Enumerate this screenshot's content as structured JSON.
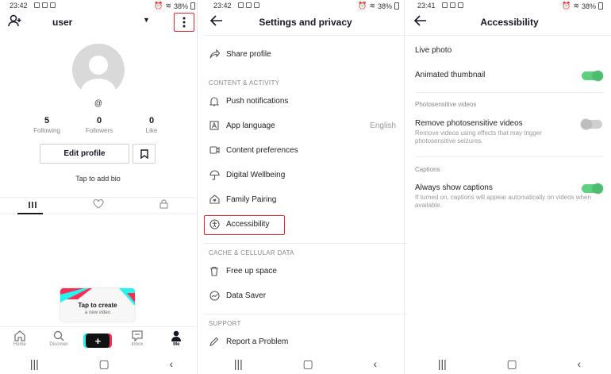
{
  "profile_screen": {
    "status": {
      "time": "23:42",
      "battery": "38%"
    },
    "header": {
      "username": "user"
    },
    "handle": "@",
    "stats": [
      {
        "count": "5",
        "label": "Following"
      },
      {
        "count": "0",
        "label": "Followers"
      },
      {
        "count": "0",
        "label": "Like"
      }
    ],
    "edit_profile_label": "Edit profile",
    "bio_prompt": "Tap to add bio",
    "create_card": {
      "title": "Tap to create",
      "subtitle": "a new video"
    },
    "bottom_nav": [
      {
        "label": "Home",
        "icon": "home-icon"
      },
      {
        "label": "Discover",
        "icon": "search-icon"
      },
      {
        "label": "+",
        "icon": "plus-icon"
      },
      {
        "label": "Inbox",
        "icon": "inbox-icon"
      },
      {
        "label": "Me",
        "icon": "person-icon"
      }
    ],
    "accent_color": "#e0282e"
  },
  "settings_screen": {
    "status": {
      "time": "23:42",
      "battery": "38%"
    },
    "title": "Settings and privacy",
    "share_profile": "Share profile",
    "sections": {
      "content_activity": "CONTENT & ACTIVITY",
      "cache_cellular": "CACHE & CELLULAR DATA",
      "support": "SUPPORT"
    },
    "items": {
      "push_notifications": "Push notifications",
      "app_language": "App language",
      "app_language_value": "English",
      "content_preferences": "Content preferences",
      "digital_wellbeing": "Digital Wellbeing",
      "family_pairing": "Family Pairing",
      "accessibility": "Accessibility",
      "free_up_space": "Free up space",
      "data_saver": "Data Saver",
      "report_problem": "Report a Problem"
    }
  },
  "accessibility_screen": {
    "status": {
      "time": "23:41",
      "battery": "38%"
    },
    "title": "Accessibility",
    "live_photo": "Live photo",
    "animated_thumbnail": {
      "label": "Animated thumbnail",
      "on": true
    },
    "section_photosensitive": "Photosensitive videos",
    "remove_photosensitive": {
      "label": "Remove photosensitive videos",
      "description": "Remove videos using effects that may trigger photosensitive seizures.",
      "on": false
    },
    "section_captions": "Captions",
    "always_show_captions": {
      "label": "Always show captions",
      "description": "If turned on, captions will appear automatically on videos when available.",
      "on": true
    },
    "toggle_on_color": "#5fcf80"
  }
}
